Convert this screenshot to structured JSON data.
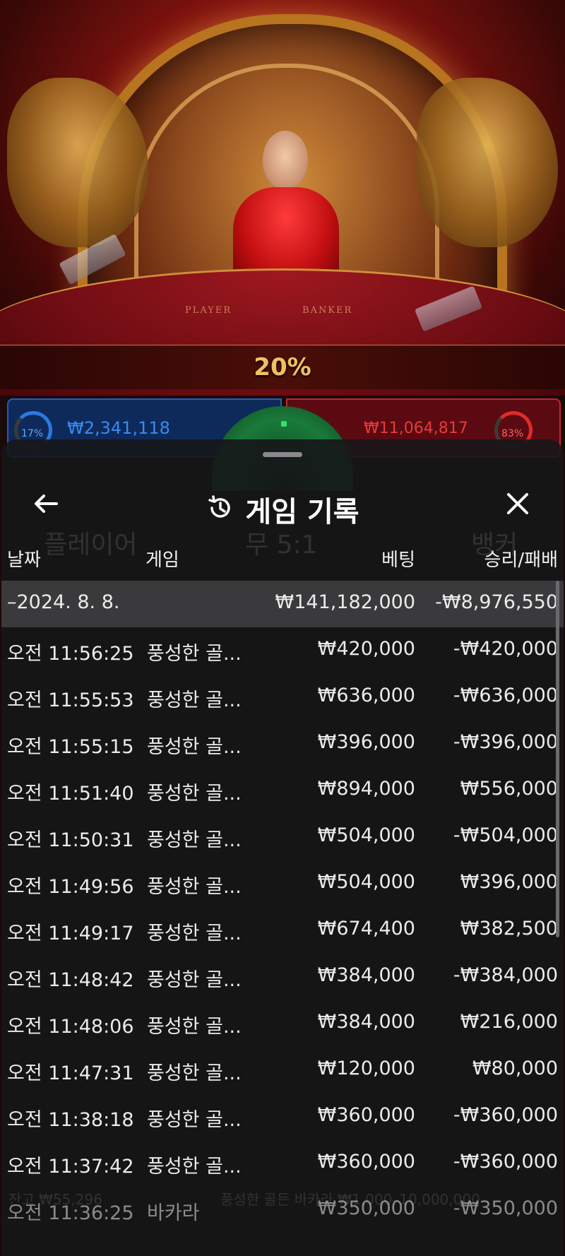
{
  "video": {
    "table_labels": {
      "player": "PLAYER",
      "banker": "BANKER"
    },
    "multiplier_banner": "20%"
  },
  "bets": {
    "player": {
      "amount": "₩2,341,118",
      "percent": "17%"
    },
    "banker": {
      "amount": "₩11,064,817",
      "percent": "83%"
    }
  },
  "behind_sheet": {
    "player_label": "플레이어",
    "tie_label": "무 5:1",
    "banker_label": "뱅커",
    "balance": "잔고 ₩55,296",
    "table_info": "풍성한 골든 바카라 ₩1,000–10,000,000"
  },
  "sheet": {
    "title": "게임 기록",
    "icons": {
      "back": "back-arrow-icon",
      "history": "history-icon",
      "close": "close-icon"
    },
    "columns": {
      "date": "날짜",
      "game": "게임",
      "bet": "베팅",
      "result": "승리/패배"
    },
    "summary": {
      "date": "–2024. 8. 8.",
      "bet": "₩141,182,000",
      "result": "-₩8,976,550"
    },
    "rows": [
      {
        "time": "오전 11:56:25",
        "game": "풍성한 골...",
        "bet": "₩420,000",
        "result": "-₩420,000"
      },
      {
        "time": "오전 11:55:53",
        "game": "풍성한 골...",
        "bet": "₩636,000",
        "result": "-₩636,000"
      },
      {
        "time": "오전 11:55:15",
        "game": "풍성한 골...",
        "bet": "₩396,000",
        "result": "-₩396,000"
      },
      {
        "time": "오전 11:51:40",
        "game": "풍성한 골...",
        "bet": "₩894,000",
        "result": "₩556,000"
      },
      {
        "time": "오전 11:50:31",
        "game": "풍성한 골...",
        "bet": "₩504,000",
        "result": "-₩504,000"
      },
      {
        "time": "오전 11:49:56",
        "game": "풍성한 골...",
        "bet": "₩504,000",
        "result": "₩396,000"
      },
      {
        "time": "오전 11:49:17",
        "game": "풍성한 골...",
        "bet": "₩674,400",
        "result": "₩382,500"
      },
      {
        "time": "오전 11:48:42",
        "game": "풍성한 골...",
        "bet": "₩384,000",
        "result": "-₩384,000"
      },
      {
        "time": "오전 11:48:06",
        "game": "풍성한 골...",
        "bet": "₩384,000",
        "result": "₩216,000"
      },
      {
        "time": "오전 11:47:31",
        "game": "풍성한 골...",
        "bet": "₩120,000",
        "result": "₩80,000"
      },
      {
        "time": "오전 11:38:18",
        "game": "풍성한 골...",
        "bet": "₩360,000",
        "result": "-₩360,000"
      },
      {
        "time": "오전 11:37:42",
        "game": "풍성한 골...",
        "bet": "₩360,000",
        "result": "-₩360,000"
      },
      {
        "time": "오전 11:36:25",
        "game": "바카라",
        "bet": "₩350,000",
        "result": "-₩350,000"
      }
    ]
  }
}
